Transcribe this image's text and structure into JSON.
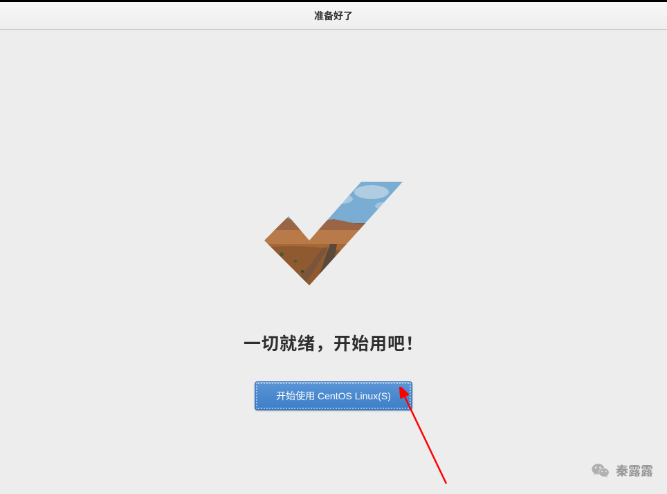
{
  "header": {
    "title": "准备好了"
  },
  "main": {
    "headline": "一切就绪，开始用吧！",
    "button_label": "开始使用 CentOS Linux(S)"
  },
  "watermark": {
    "text": "秦露露"
  },
  "icons": {
    "checkmark": "checkmark-landscape-icon",
    "wechat": "wechat-icon",
    "arrow": "annotation-arrow"
  }
}
